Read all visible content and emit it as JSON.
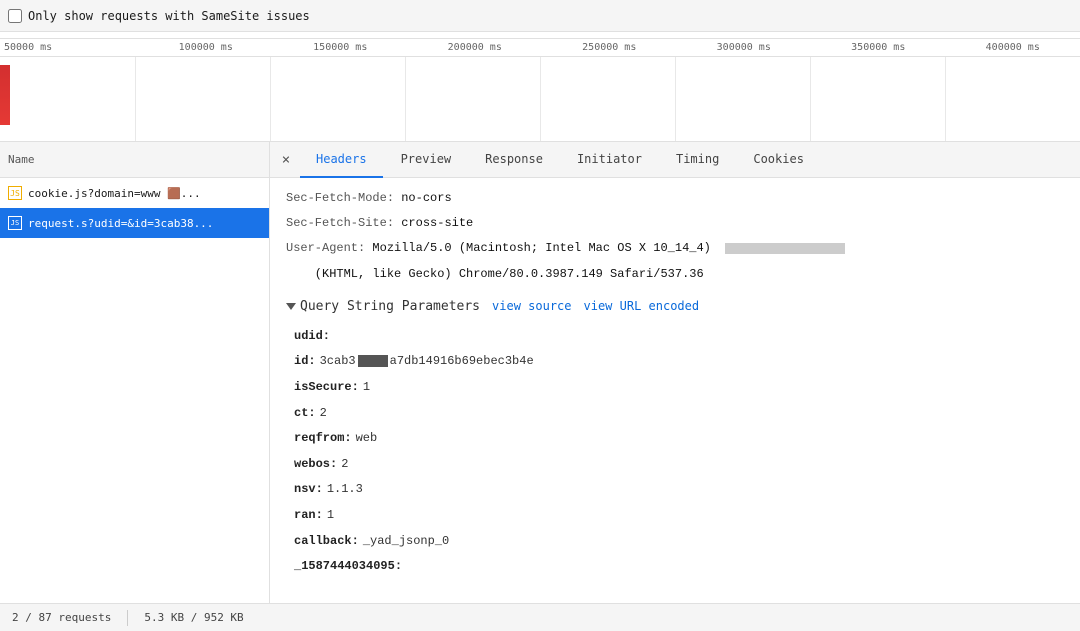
{
  "topbar": {
    "checkbox_label": "Only show requests with SameSite issues"
  },
  "timeline": {
    "labels": [
      "50000 ms",
      "100000 ms",
      "150000 ms",
      "200000 ms",
      "250000 ms",
      "300000 ms",
      "350000 ms",
      "400000 ms"
    ]
  },
  "left_panel": {
    "header": "Name",
    "files": [
      {
        "name": "cookie.js?domain=www 🟫...",
        "type": "js",
        "active": false
      },
      {
        "name": "request.s?udid=&id=3cab38...",
        "type": "active",
        "active": true
      }
    ]
  },
  "tabs": {
    "close_label": "×",
    "items": [
      "Headers",
      "Preview",
      "Response",
      "Initiator",
      "Timing",
      "Cookies"
    ],
    "active": "Headers"
  },
  "headers": [
    {
      "key": "Sec-Fetch-Mode:",
      "value": " no-cors"
    },
    {
      "key": "Sec-Fetch-Site:",
      "value": " cross-site"
    },
    {
      "key": "User-Agent:",
      "value": " Mozilla/5.0 (Macintosh; Intel Mac OS X 10_14_4)  AppleWebKit/537...."
    },
    {
      "key": "",
      "value": " (KHTML, like Gecko) Chrome/80.0.3987.149 Safari/537.36"
    }
  ],
  "query_string": {
    "title": "Query String Parameters",
    "view_source_label": "view source",
    "view_url_encoded_label": "view URL encoded",
    "params": [
      {
        "key": "udid:",
        "value": "",
        "has_redacted": false
      },
      {
        "key": "id:",
        "value": "a7db14916b69ebec3b4e",
        "has_redacted": true,
        "redacted_prefix": "3cab3"
      },
      {
        "key": "isSecure:",
        "value": "1",
        "has_redacted": false
      },
      {
        "key": "ct:",
        "value": "2",
        "has_redacted": false
      },
      {
        "key": "reqfrom:",
        "value": "web",
        "has_redacted": false
      },
      {
        "key": "webos:",
        "value": "2",
        "has_redacted": false
      },
      {
        "key": "nsv:",
        "value": "1.1.3",
        "has_redacted": false
      },
      {
        "key": "ran:",
        "value": "1",
        "has_redacted": false
      },
      {
        "key": "callback:",
        "value": "_yad_jsonp_0",
        "has_redacted": false
      },
      {
        "key": "_1587444034095:",
        "value": "",
        "has_redacted": false
      }
    ]
  },
  "statusbar": {
    "requests": "2 / 87 requests",
    "size": "5.3 KB / 952 KB"
  }
}
